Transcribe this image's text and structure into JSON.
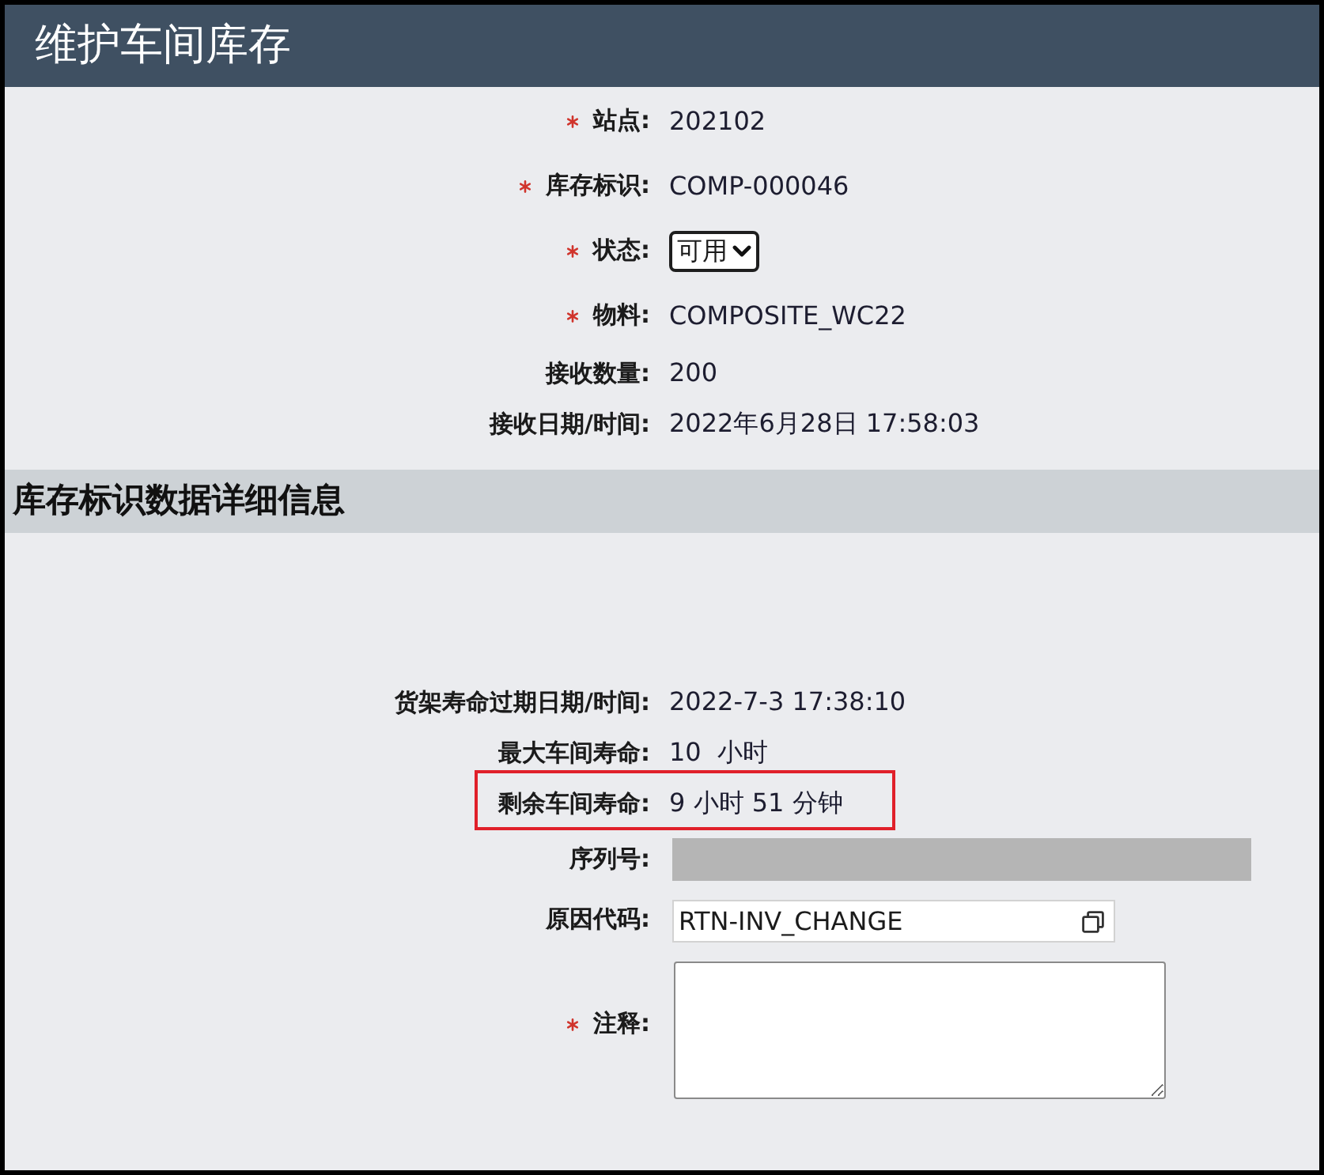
{
  "header": {
    "title": "维护车间库存"
  },
  "main_fields": [
    {
      "kind": "text",
      "label": "站点:",
      "required": true,
      "value": "202102"
    },
    {
      "kind": "text",
      "label": "库存标识:",
      "required": true,
      "value": "COMP-000046"
    },
    {
      "kind": "select",
      "label": "状态:",
      "required": true,
      "value": "可用"
    },
    {
      "kind": "text",
      "label": "物料:",
      "required": true,
      "value": "COMPOSITE_WC22"
    },
    {
      "kind": "text",
      "label": "接收数量:",
      "required": false,
      "value": "200"
    },
    {
      "kind": "text",
      "label": "接收日期/时间:",
      "required": false,
      "value": "2022年6月28日 17:58:03"
    }
  ],
  "details": {
    "title": "库存标识数据详细信息",
    "fields": [
      {
        "kind": "text",
        "label": "货架寿命过期日期/时间:",
        "required": false,
        "highlighted": false,
        "disabled": false,
        "value": "2022-7-3 17:38:10"
      },
      {
        "kind": "text",
        "label": "最大车间寿命:",
        "required": false,
        "highlighted": false,
        "disabled": false,
        "value": "10  小时"
      },
      {
        "kind": "text",
        "label": "剩余车间寿命:",
        "required": false,
        "highlighted": true,
        "disabled": false,
        "value": "9 小时 51 分钟"
      },
      {
        "kind": "input",
        "label": "序列号:",
        "required": false,
        "highlighted": false,
        "disabled": true
      },
      {
        "kind": "lookup",
        "label": "原因代码:",
        "required": false,
        "highlighted": false,
        "disabled": false,
        "value": "RTN-INV_CHANGE"
      },
      {
        "kind": "textarea",
        "label": "注释:",
        "required": true,
        "highlighted": false,
        "disabled": false
      }
    ]
  }
}
